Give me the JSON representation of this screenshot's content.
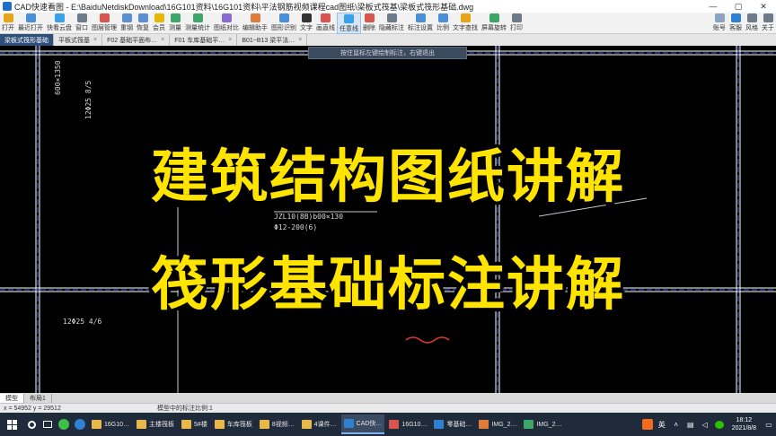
{
  "window": {
    "title": "CAD快速看图 - E:\\BaiduNetdiskDownload\\16G101资料\\16G101资料\\平法钢筋视频课程cad图纸\\梁板式筏基\\梁板式筏形基础.dwg",
    "minimize": "—",
    "maximize": "▢",
    "close": "✕"
  },
  "toolbar": {
    "items": [
      {
        "label": "打开",
        "color": "#e8a317"
      },
      {
        "label": "最近打开",
        "color": "#4a90d9"
      },
      {
        "label": "快看云盘",
        "color": "#3aa0e8"
      },
      {
        "label": "窗口",
        "color": "#6c7a89"
      },
      {
        "label": "图层管理",
        "color": "#d9534f"
      },
      {
        "label": "重钢",
        "color": "#5b8fd1"
      },
      {
        "label": "恢复",
        "color": "#5b8fd1"
      },
      {
        "label": "会员",
        "color": "#e6b800"
      },
      {
        "label": "测量",
        "color": "#3fa66a"
      },
      {
        "label": "测量统计",
        "color": "#3fa66a"
      },
      {
        "label": "图纸对比",
        "color": "#8a6cd1"
      },
      {
        "label": "编辑助手",
        "color": "#e07b39"
      },
      {
        "label": "图形识别",
        "color": "#4a90d9"
      },
      {
        "label": "文字",
        "color": "#333333"
      },
      {
        "label": "画直线",
        "color": "#d9534f"
      },
      {
        "label": "任意线",
        "color": "#3aa0e8"
      },
      {
        "label": "删除",
        "color": "#d9534f"
      },
      {
        "label": "隐藏标注",
        "color": "#6c7a89"
      },
      {
        "label": "标注设置",
        "color": "#4a90d9"
      },
      {
        "label": "比例",
        "color": "#4a90d9"
      },
      {
        "label": "文字查找",
        "color": "#e8a317"
      },
      {
        "label": "屏幕旋转",
        "color": "#3fa66a"
      },
      {
        "label": "打印",
        "color": "#6c7a89"
      }
    ],
    "right_items": [
      {
        "label": "账号",
        "color": "#8aa4c4"
      },
      {
        "label": "客服",
        "color": "#2f80d1"
      },
      {
        "label": "风格",
        "color": "#6c7a89"
      },
      {
        "label": "关于",
        "color": "#6c7a89"
      }
    ],
    "active_item": "任意线"
  },
  "tabs": [
    {
      "label": "梁板式筏形基础",
      "closable": false
    },
    {
      "label": "平板式筏基",
      "closable": true
    },
    {
      "label": "F02 基础平面布…",
      "closable": true
    },
    {
      "label": "F01 车库基础平…",
      "closable": true
    },
    {
      "label": "B01~B13 梁平法…",
      "closable": true
    }
  ],
  "canvas": {
    "hint": "按住鼠标左键绘制标注，右键退出",
    "overlay_line1": "建筑结构图纸讲解",
    "overlay_line2": "筏形基础标注讲解",
    "cad_labels": [
      "JZL10(8B)b00×130",
      "Φ12-200(6)",
      "12Φ25 4/6",
      "12Φ25 8/5",
      "600×1350"
    ]
  },
  "model_tabs": [
    "模型",
    "布局1"
  ],
  "status": {
    "coords": "x = 54952 y = 29512",
    "scale": "模型中的标注比例:1"
  },
  "taskbar": {
    "tasks": [
      {
        "label": "16G10…",
        "color": "#e8b84a"
      },
      {
        "label": "主楼筏板",
        "color": "#e8b84a"
      },
      {
        "label": "5#楼",
        "color": "#e8b84a"
      },
      {
        "label": "车库筏板",
        "color": "#e8b84a"
      },
      {
        "label": "8视频…",
        "color": "#e8b84a"
      },
      {
        "label": "4课件…",
        "color": "#e8b84a"
      },
      {
        "label": "CAD快…",
        "color": "#2f80d1"
      },
      {
        "label": "16G10…",
        "color": "#d9534f"
      },
      {
        "label": "零基础…",
        "color": "#2f80d1"
      },
      {
        "label": "IMG_2…",
        "color": "#e07b39"
      },
      {
        "label": "IMG_2…",
        "color": "#3fa66a"
      }
    ],
    "active_task": "CAD快…",
    "tray_ime": "英",
    "time": "18:12",
    "date": "2021/8/8"
  }
}
